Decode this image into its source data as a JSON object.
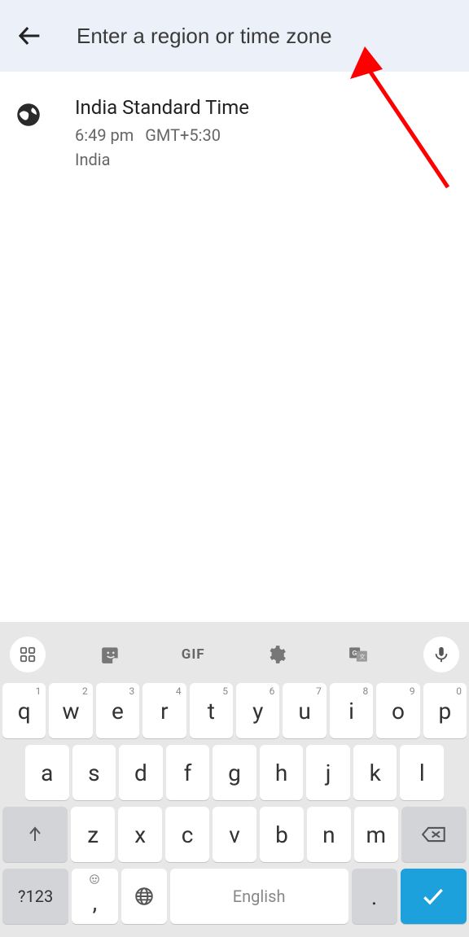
{
  "header": {
    "search_placeholder": "Enter a region or time zone",
    "search_value": ""
  },
  "results": [
    {
      "title": "India Standard Time",
      "time": "6:49 pm",
      "offset": "GMT+5:30",
      "country": "India"
    }
  ],
  "keyboard": {
    "toolbar": {
      "gif": "GIF"
    },
    "row1": [
      {
        "l": "q",
        "s": "1"
      },
      {
        "l": "w",
        "s": "2"
      },
      {
        "l": "e",
        "s": "3"
      },
      {
        "l": "r",
        "s": "4"
      },
      {
        "l": "t",
        "s": "5"
      },
      {
        "l": "y",
        "s": "6"
      },
      {
        "l": "u",
        "s": "7"
      },
      {
        "l": "i",
        "s": "8"
      },
      {
        "l": "o",
        "s": "9"
      },
      {
        "l": "p",
        "s": "0"
      }
    ],
    "row2": [
      "a",
      "s",
      "d",
      "f",
      "g",
      "h",
      "j",
      "k",
      "l"
    ],
    "row3": [
      "z",
      "x",
      "c",
      "v",
      "b",
      "n",
      "m"
    ],
    "bottom": {
      "numsym": "?123",
      "comma": ",",
      "space": "English",
      "period": "."
    }
  }
}
